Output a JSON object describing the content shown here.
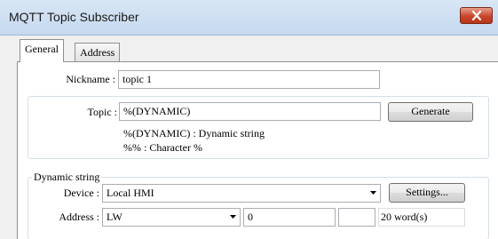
{
  "window": {
    "title": "MQTT Topic Subscriber",
    "close_icon": "close-icon"
  },
  "tabs": [
    {
      "label": "General",
      "active": true
    },
    {
      "label": "Address",
      "active": false
    }
  ],
  "nickname": {
    "label": "Nickname :",
    "value": "topic 1"
  },
  "topic": {
    "label": "Topic :",
    "value": "%(DYNAMIC)",
    "generate_label": "Generate",
    "hint_line1": "%(DYNAMIC) : Dynamic string",
    "hint_line2": "%% : Character %"
  },
  "dynamic_string": {
    "legend": "Dynamic string",
    "device_label": "Device :",
    "device_value": "Local HMI",
    "settings_label": "Settings...",
    "address_label": "Address :",
    "address_type": "LW",
    "address_value": "0",
    "address_extra": "",
    "word_count": "20 word(s)"
  },
  "colors": {
    "titlebar": "#c6d9ef",
    "close_button": "#c8452a",
    "tab_page": "#ffffff",
    "window_bg": "#f0f0f0"
  }
}
